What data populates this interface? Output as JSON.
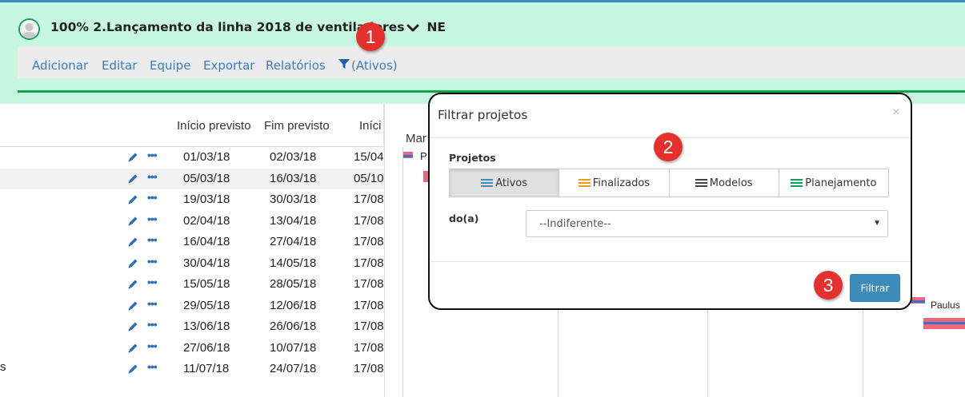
{
  "header": {
    "project_title": "100% 2.Lançamento da linha 2018 de ventiladores",
    "project_title_tail": "NE",
    "menu": [
      "Adicionar",
      "Editar",
      "Equipe",
      "Exportar",
      "Relatórios"
    ],
    "filter_label": "(Ativos)"
  },
  "table": {
    "headers": {
      "inicio_previsto": "Início previsto",
      "fim_previsto": "Fim previsto",
      "inicio": "Iníci"
    },
    "rows": [
      {
        "start": "01/03/18",
        "end": "02/03/18",
        "inicio": "15/04"
      },
      {
        "start": "05/03/18",
        "end": "16/03/18",
        "inicio": "05/10"
      },
      {
        "start": "19/03/18",
        "end": "30/03/18",
        "inicio": "17/08"
      },
      {
        "start": "02/04/18",
        "end": "13/04/18",
        "inicio": "17/08"
      },
      {
        "start": "16/04/18",
        "end": "27/04/18",
        "inicio": "17/08"
      },
      {
        "start": "30/04/18",
        "end": "14/05/18",
        "inicio": "17/08"
      },
      {
        "start": "15/05/18",
        "end": "28/05/18",
        "inicio": "17/08"
      },
      {
        "start": "29/05/18",
        "end": "12/06/18",
        "inicio": "17/08"
      },
      {
        "start": "13/06/18",
        "end": "26/06/18",
        "inicio": "17/08"
      },
      {
        "start": "27/06/18",
        "end": "10/07/18",
        "inicio": "17/08"
      },
      {
        "start": "11/07/18",
        "end": "24/07/18",
        "inicio": "17/08"
      }
    ],
    "dots": "•••",
    "left_stub": "s"
  },
  "gantt": {
    "month_label": "Mar",
    "first_task_label": "P",
    "assignee": "Paulus"
  },
  "modal": {
    "title": "Filtrar projetos",
    "close": "×",
    "projetos_label": "Projetos",
    "segments": [
      {
        "label": "Ativos",
        "color": "#3c8dbc"
      },
      {
        "label": "Finalizados",
        "color": "#f39c12"
      },
      {
        "label": "Modelos",
        "color": "#444444"
      },
      {
        "label": "Planejamento",
        "color": "#00a65a"
      }
    ],
    "active_segment": "Ativos",
    "doa_label": "do(a)",
    "select_value": "--Indiferente--",
    "filter_button": "Filtrar"
  },
  "badges": [
    "1",
    "2",
    "3"
  ],
  "colors": {
    "accent": "#3c8dbc",
    "header_bg": "#c8f7e1",
    "badge": "#e5312d",
    "green_line": "#12a24b"
  }
}
